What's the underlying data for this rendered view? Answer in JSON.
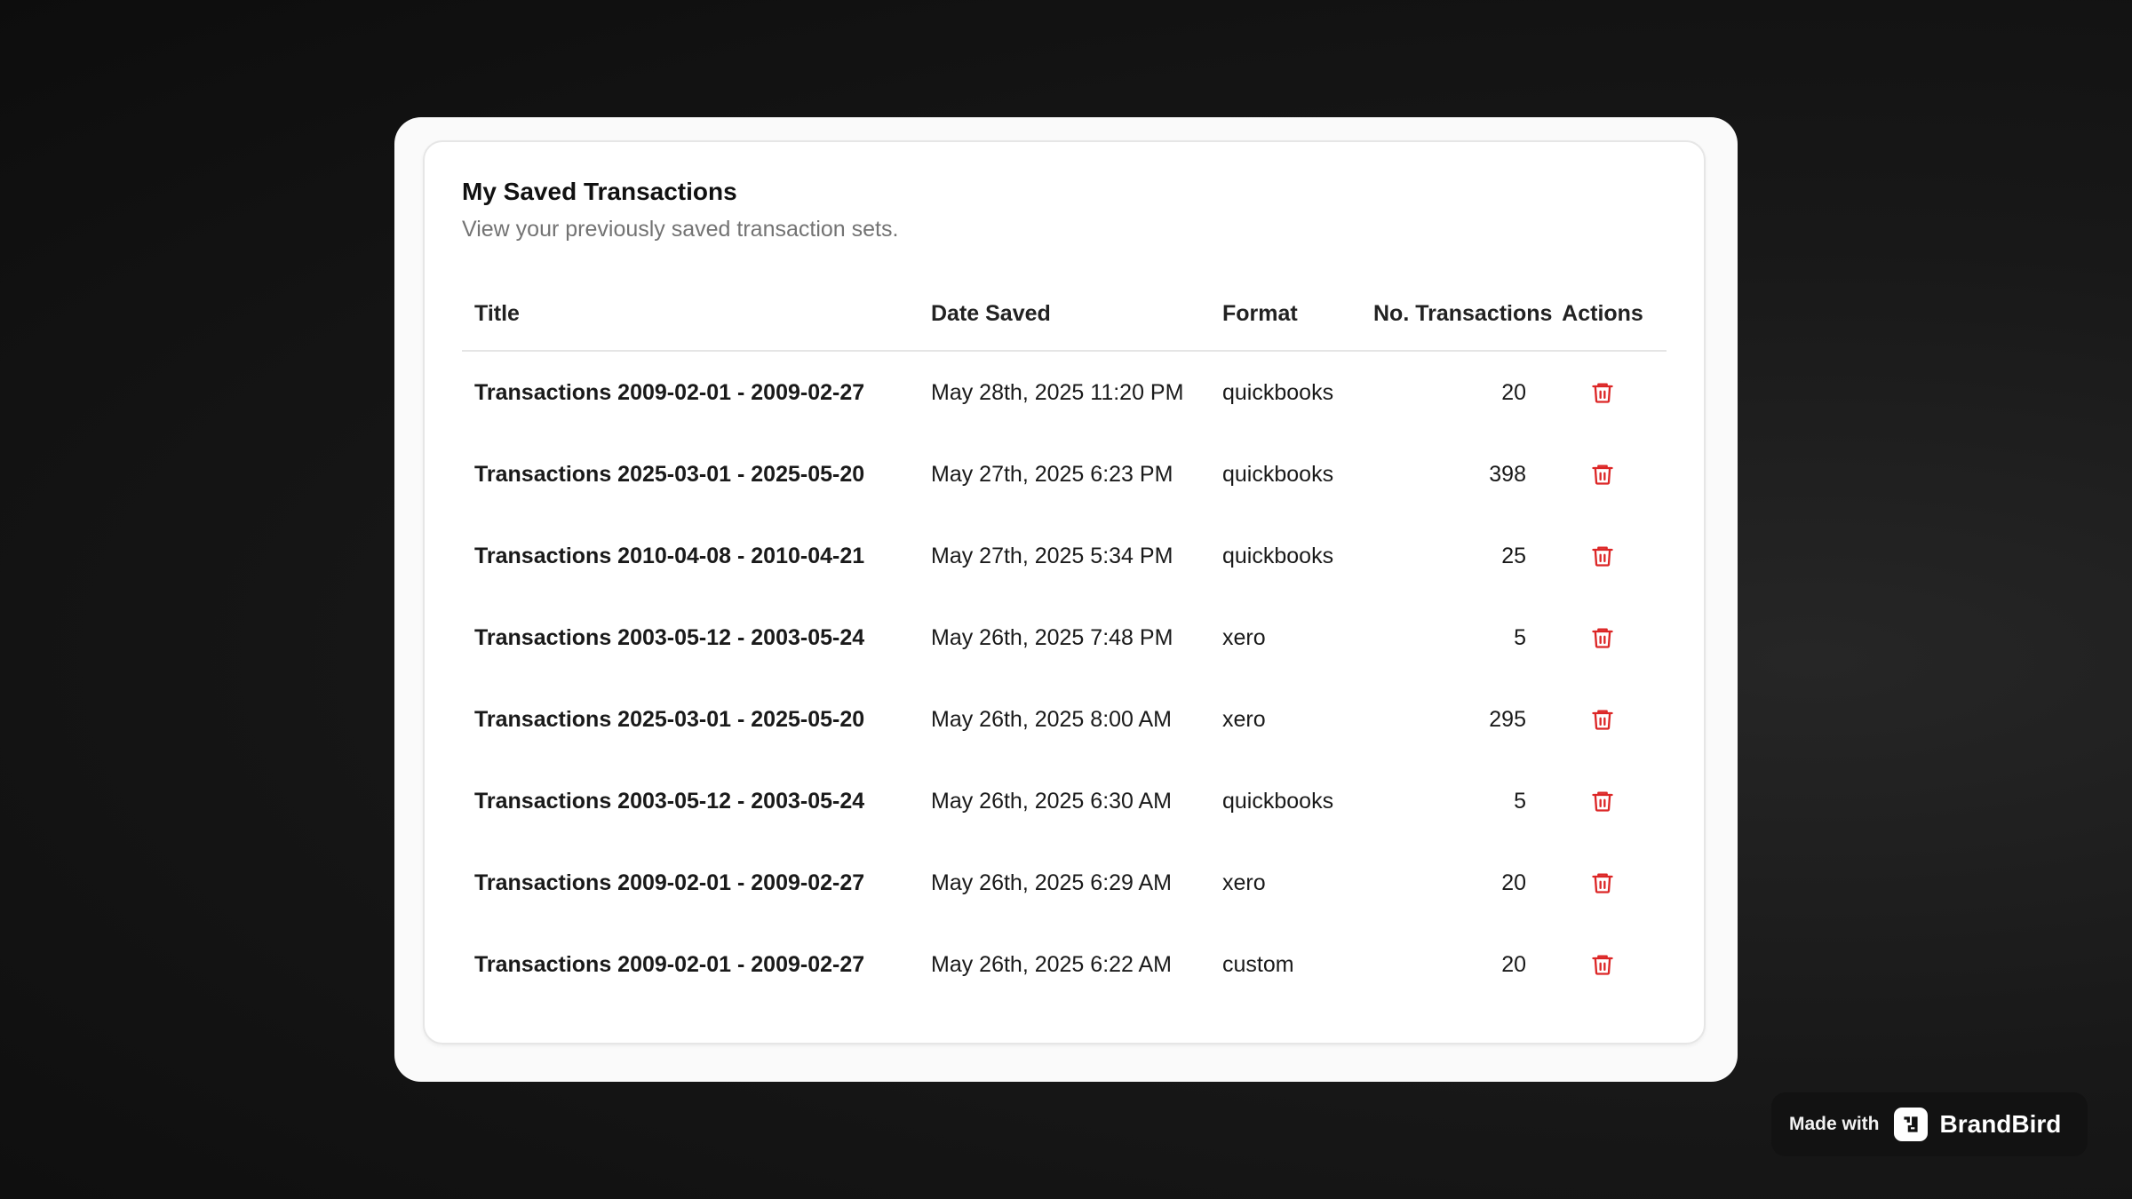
{
  "card": {
    "title": "My Saved Transactions",
    "subtitle": "View your previously saved transaction sets."
  },
  "table": {
    "columns": {
      "title": "Title",
      "date_saved": "Date Saved",
      "format": "Format",
      "count": "No. Transactions",
      "actions": "Actions"
    },
    "rows": [
      {
        "title": "Transactions 2009-02-01 - 2009-02-27",
        "date_saved": "May 28th, 2025 11:20 PM",
        "format": "quickbooks",
        "count": "20"
      },
      {
        "title": "Transactions 2025-03-01 - 2025-05-20",
        "date_saved": "May 27th, 2025 6:23 PM",
        "format": "quickbooks",
        "count": "398"
      },
      {
        "title": "Transactions 2010-04-08 - 2010-04-21",
        "date_saved": "May 27th, 2025 5:34 PM",
        "format": "quickbooks",
        "count": "25"
      },
      {
        "title": "Transactions 2003-05-12 - 2003-05-24",
        "date_saved": "May 26th, 2025 7:48 PM",
        "format": "xero",
        "count": "5"
      },
      {
        "title": "Transactions 2025-03-01 - 2025-05-20",
        "date_saved": "May 26th, 2025 8:00 AM",
        "format": "xero",
        "count": "295"
      },
      {
        "title": "Transactions 2003-05-12 - 2003-05-24",
        "date_saved": "May 26th, 2025 6:30 AM",
        "format": "quickbooks",
        "count": "5"
      },
      {
        "title": "Transactions 2009-02-01 - 2009-02-27",
        "date_saved": "May 26th, 2025 6:29 AM",
        "format": "xero",
        "count": "20"
      },
      {
        "title": "Transactions 2009-02-01 - 2009-02-27",
        "date_saved": "May 26th, 2025 6:22 AM",
        "format": "custom",
        "count": "20"
      }
    ],
    "action_icon": "trash-icon"
  },
  "badge": {
    "made_with": "Made with",
    "brand": "BrandBird"
  },
  "colors": {
    "danger": "#dc2626",
    "muted_text": "#737373"
  }
}
